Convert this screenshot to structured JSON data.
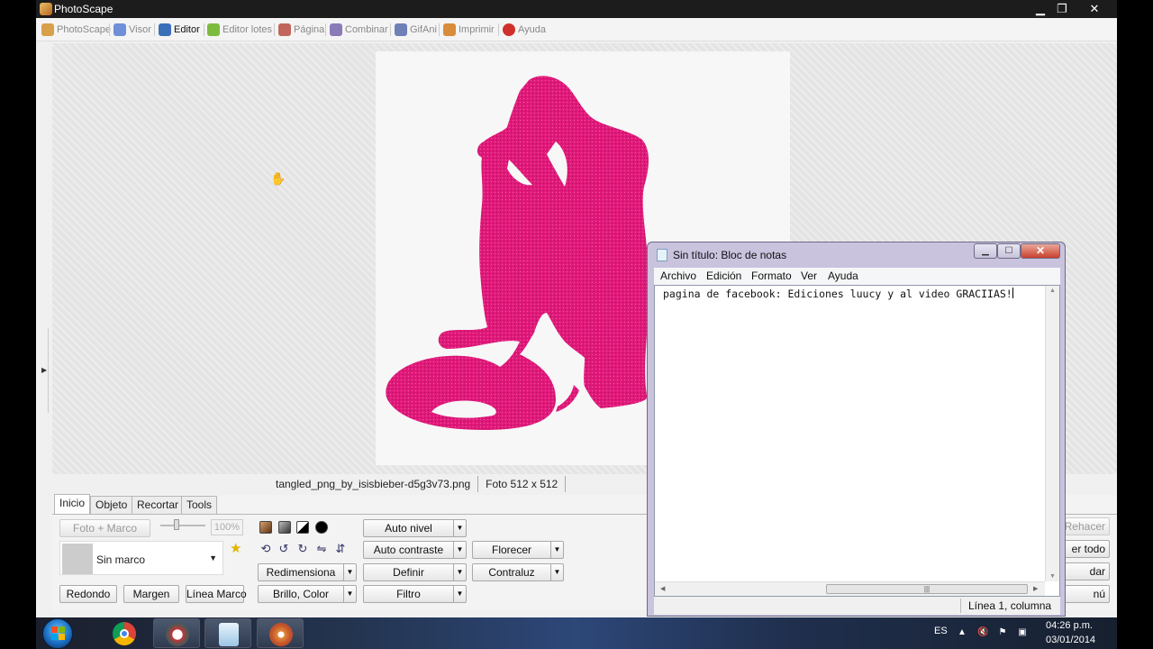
{
  "photoscape": {
    "window_title": "PhotoScape",
    "tabs": [
      {
        "label": "PhotoScape",
        "color": "#d8a04a"
      },
      {
        "label": "Visor",
        "color": "#6f8fd8"
      },
      {
        "label": "Editor",
        "color": "#3b6fb8",
        "active": true
      },
      {
        "label": "Editor lotes",
        "color": "#7dbb3e"
      },
      {
        "label": "Página",
        "color": "#c0665a"
      },
      {
        "label": "Combinar",
        "color": "#8a7ab8"
      },
      {
        "label": "GifAni",
        "color": "#6f7fb8"
      },
      {
        "label": "Imprimir",
        "color": "#d98c3a"
      },
      {
        "label": "Ayuda",
        "color": "#d0302a"
      }
    ],
    "status": {
      "filename": "tangled_png_by_isisbieber-d5g3v73.png",
      "photo_size": "Foto 512 x 512"
    },
    "image_fill_color": "#e0197a",
    "bottom_tabs": [
      "Inicio",
      "Objeto",
      "Recortar",
      "Tools"
    ],
    "inicio": {
      "photo_frame_button": "Foto + Marco",
      "zoom_value": "100%",
      "frame_name": "Sin marco",
      "round_button": "Redondo",
      "margin_button": "Margen",
      "frame_line_button": "Línea Marco",
      "resize_button": "Redimensiona",
      "brightness_button": "Brillo, Color",
      "auto_level_button": "Auto nivel",
      "auto_contrast_button": "Auto contraste",
      "sharpen_button": "Definir",
      "filter_button": "Filtro",
      "bloom_button": "Florecer",
      "backlight_button": "Contraluz"
    },
    "right_partial_buttons": {
      "redo": "Rehacer",
      "undo_all": "er todo",
      "save": "dar",
      "menu": "nú"
    }
  },
  "notepad": {
    "title": "Sin título: Bloc de notas",
    "menu": [
      "Archivo",
      "Edición",
      "Formato",
      "Ver",
      "Ayuda"
    ],
    "content": "pagina de facebook: Ediciones luucy y al video GRACIIAS!",
    "status": "Línea 1, columna"
  },
  "taskbar": {
    "language": "ES",
    "time": "04:26 p.m.",
    "date": "03/01/2014",
    "apps": [
      "chrome-icon",
      "photoscape-app-icon",
      "notepad-app-icon",
      "photoscape-reel-icon"
    ]
  }
}
